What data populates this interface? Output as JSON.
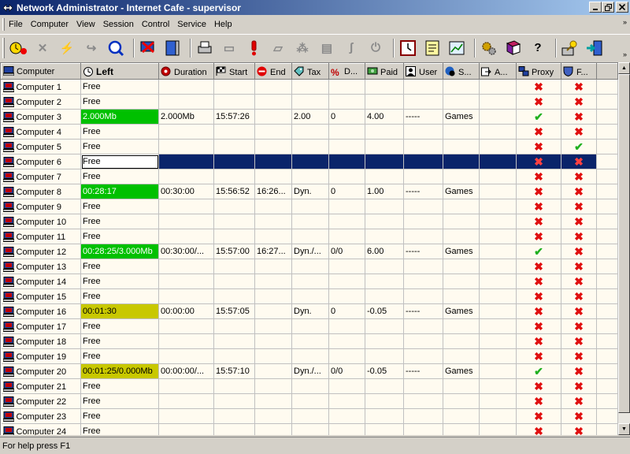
{
  "window": {
    "title": "Network Administrator - Internet Cafe - supervisor"
  },
  "menu": [
    "File",
    "Computer",
    "View",
    "Session",
    "Control",
    "Service",
    "Help"
  ],
  "status": {
    "text": "For help press F1"
  },
  "columns": [
    "Computer",
    "Left",
    "Duration",
    "Start",
    "End",
    "Tax",
    "D...",
    "Paid",
    "User",
    "S...",
    "A...",
    "Proxy",
    "F..."
  ],
  "rows": [
    {
      "computer": "Computer 1",
      "left": "Free",
      "duration": "",
      "start": "",
      "end": "",
      "tax": "",
      "d": "",
      "paid": "",
      "user": "",
      "s": "",
      "a": "",
      "proxy": "x",
      "f": "x",
      "state": ""
    },
    {
      "computer": "Computer 2",
      "left": "Free",
      "duration": "",
      "start": "",
      "end": "",
      "tax": "",
      "d": "",
      "paid": "",
      "user": "",
      "s": "",
      "a": "",
      "proxy": "x",
      "f": "x",
      "state": ""
    },
    {
      "computer": "Computer 3",
      "left": "2.000Mb",
      "duration": "2.000Mb",
      "start": "15:57:26",
      "end": "",
      "tax": "2.00",
      "d": "0",
      "paid": "4.00",
      "user": "-----",
      "s": "Games",
      "a": "",
      "proxy": "ok",
      "f": "x",
      "state": "green"
    },
    {
      "computer": "Computer 4",
      "left": "Free",
      "duration": "",
      "start": "",
      "end": "",
      "tax": "",
      "d": "",
      "paid": "",
      "user": "",
      "s": "",
      "a": "",
      "proxy": "x",
      "f": "x",
      "state": ""
    },
    {
      "computer": "Computer 5",
      "left": "Free",
      "duration": "",
      "start": "",
      "end": "",
      "tax": "",
      "d": "",
      "paid": "",
      "user": "",
      "s": "",
      "a": "",
      "proxy": "x",
      "f": "ok",
      "state": ""
    },
    {
      "computer": "Computer 6",
      "left": "Free",
      "duration": "",
      "start": "",
      "end": "",
      "tax": "",
      "d": "",
      "paid": "",
      "user": "",
      "s": "",
      "a": "",
      "proxy": "x",
      "f": "x",
      "state": "selected"
    },
    {
      "computer": "Computer 7",
      "left": "Free",
      "duration": "",
      "start": "",
      "end": "",
      "tax": "",
      "d": "",
      "paid": "",
      "user": "",
      "s": "",
      "a": "",
      "proxy": "x",
      "f": "x",
      "state": ""
    },
    {
      "computer": "Computer 8",
      "left": "00:28:17",
      "duration": "00:30:00",
      "start": "15:56:52",
      "end": "16:26...",
      "tax": "Dyn.",
      "d": "0",
      "paid": "1.00",
      "user": "-----",
      "s": "Games",
      "a": "",
      "proxy": "x",
      "f": "x",
      "state": "green"
    },
    {
      "computer": "Computer 9",
      "left": "Free",
      "duration": "",
      "start": "",
      "end": "",
      "tax": "",
      "d": "",
      "paid": "",
      "user": "",
      "s": "",
      "a": "",
      "proxy": "x",
      "f": "x",
      "state": ""
    },
    {
      "computer": "Computer 10",
      "left": "Free",
      "duration": "",
      "start": "",
      "end": "",
      "tax": "",
      "d": "",
      "paid": "",
      "user": "",
      "s": "",
      "a": "",
      "proxy": "x",
      "f": "x",
      "state": ""
    },
    {
      "computer": "Computer 11",
      "left": "Free",
      "duration": "",
      "start": "",
      "end": "",
      "tax": "",
      "d": "",
      "paid": "",
      "user": "",
      "s": "",
      "a": "",
      "proxy": "x",
      "f": "x",
      "state": ""
    },
    {
      "computer": "Computer 12",
      "left": "00:28:25/3.000Mb",
      "duration": "00:30:00/...",
      "start": "15:57:00",
      "end": "16:27...",
      "tax": "Dyn./...",
      "d": "0/0",
      "paid": "6.00",
      "user": "-----",
      "s": "Games",
      "a": "",
      "proxy": "ok",
      "f": "x",
      "state": "green"
    },
    {
      "computer": "Computer 13",
      "left": "Free",
      "duration": "",
      "start": "",
      "end": "",
      "tax": "",
      "d": "",
      "paid": "",
      "user": "",
      "s": "",
      "a": "",
      "proxy": "x",
      "f": "x",
      "state": ""
    },
    {
      "computer": "Computer 14",
      "left": "Free",
      "duration": "",
      "start": "",
      "end": "",
      "tax": "",
      "d": "",
      "paid": "",
      "user": "",
      "s": "",
      "a": "",
      "proxy": "x",
      "f": "x",
      "state": ""
    },
    {
      "computer": "Computer 15",
      "left": "Free",
      "duration": "",
      "start": "",
      "end": "",
      "tax": "",
      "d": "",
      "paid": "",
      "user": "",
      "s": "",
      "a": "",
      "proxy": "x",
      "f": "x",
      "state": ""
    },
    {
      "computer": "Computer 16",
      "left": "00:01:30",
      "duration": "00:00:00",
      "start": "15:57:05",
      "end": "",
      "tax": "Dyn.",
      "d": "0",
      "paid": "-0.05",
      "user": "-----",
      "s": "Games",
      "a": "",
      "proxy": "x",
      "f": "x",
      "state": "olive"
    },
    {
      "computer": "Computer 17",
      "left": "Free",
      "duration": "",
      "start": "",
      "end": "",
      "tax": "",
      "d": "",
      "paid": "",
      "user": "",
      "s": "",
      "a": "",
      "proxy": "x",
      "f": "x",
      "state": ""
    },
    {
      "computer": "Computer 18",
      "left": "Free",
      "duration": "",
      "start": "",
      "end": "",
      "tax": "",
      "d": "",
      "paid": "",
      "user": "",
      "s": "",
      "a": "",
      "proxy": "x",
      "f": "x",
      "state": ""
    },
    {
      "computer": "Computer 19",
      "left": "Free",
      "duration": "",
      "start": "",
      "end": "",
      "tax": "",
      "d": "",
      "paid": "",
      "user": "",
      "s": "",
      "a": "",
      "proxy": "x",
      "f": "x",
      "state": ""
    },
    {
      "computer": "Computer 20",
      "left": "00:01:25/0.000Mb",
      "duration": "00:00:00/...",
      "start": "15:57:10",
      "end": "",
      "tax": "Dyn./...",
      "d": "0/0",
      "paid": "-0.05",
      "user": "-----",
      "s": "Games",
      "a": "",
      "proxy": "ok",
      "f": "x",
      "state": "olive"
    },
    {
      "computer": "Computer 21",
      "left": "Free",
      "duration": "",
      "start": "",
      "end": "",
      "tax": "",
      "d": "",
      "paid": "",
      "user": "",
      "s": "",
      "a": "",
      "proxy": "x",
      "f": "x",
      "state": ""
    },
    {
      "computer": "Computer 22",
      "left": "Free",
      "duration": "",
      "start": "",
      "end": "",
      "tax": "",
      "d": "",
      "paid": "",
      "user": "",
      "s": "",
      "a": "",
      "proxy": "x",
      "f": "x",
      "state": ""
    },
    {
      "computer": "Computer 23",
      "left": "Free",
      "duration": "",
      "start": "",
      "end": "",
      "tax": "",
      "d": "",
      "paid": "",
      "user": "",
      "s": "",
      "a": "",
      "proxy": "x",
      "f": "x",
      "state": ""
    },
    {
      "computer": "Computer 24",
      "left": "Free",
      "duration": "",
      "start": "",
      "end": "",
      "tax": "",
      "d": "",
      "paid": "",
      "user": "",
      "s": "",
      "a": "",
      "proxy": "x",
      "f": "x",
      "state": ""
    }
  ]
}
